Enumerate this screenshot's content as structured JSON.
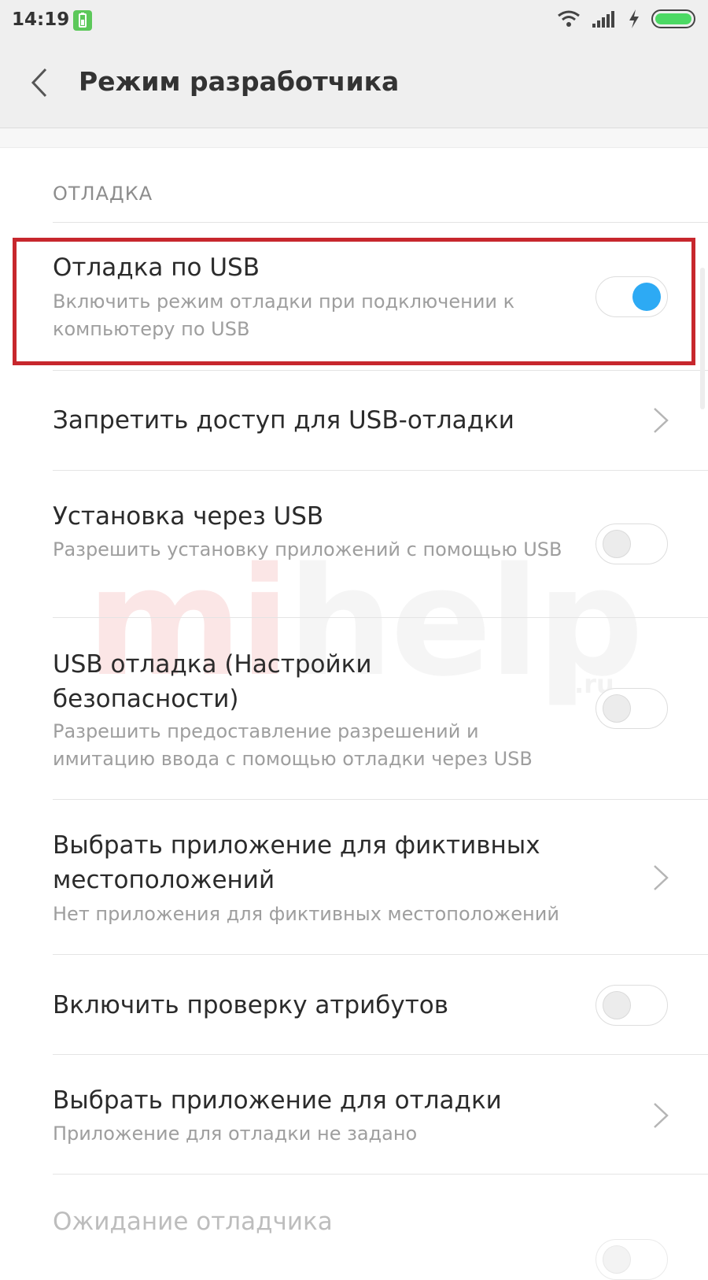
{
  "status_bar": {
    "time": "14:19"
  },
  "app_bar": {
    "title": "Режим разработчика"
  },
  "watermark": {
    "part1": "mi",
    "part2": "help",
    "suffix": ".ru"
  },
  "section": {
    "header": "ОТЛАДКА"
  },
  "settings": [
    {
      "title": "Отладка по USB",
      "subtitle": "Включить режим отладки при подключении к компьютеру по USB",
      "control": "toggle",
      "enabled": true
    },
    {
      "title": "Запретить доступ для USB-отладки",
      "subtitle": "",
      "control": "chevron"
    },
    {
      "title": "Установка через USB",
      "subtitle": "Разрешить установку приложений с помощью USB",
      "control": "toggle",
      "enabled": false
    },
    {
      "title": "USB отладка (Настройки безопасности)",
      "subtitle": "Разрешить предоставление разрешений и имитацию ввода с помощью отладки через USB",
      "control": "toggle",
      "enabled": false
    },
    {
      "title": "Выбрать приложение для фиктивных местоположений",
      "subtitle": "Нет приложения для фиктивных местоположений",
      "control": "chevron"
    },
    {
      "title": "Включить проверку атрибутов",
      "subtitle": "",
      "control": "toggle",
      "enabled": false
    },
    {
      "title": "Выбрать приложение для отладки",
      "subtitle": "Приложение для отладки не задано",
      "control": "chevron"
    },
    {
      "title": "Ожидание отладчика",
      "subtitle": "",
      "control": "toggle",
      "enabled": false,
      "disabled": true
    }
  ],
  "colors": {
    "accent": "#2daaf4",
    "highlight_border": "#c7272d",
    "battery": "#4cd964"
  },
  "icons": {
    "back": "chevron-left-icon",
    "chevron": "chevron-right-icon",
    "wifi": "wifi-icon",
    "signal": "signal-icon",
    "charging": "charging-icon",
    "battery": "battery-icon"
  }
}
